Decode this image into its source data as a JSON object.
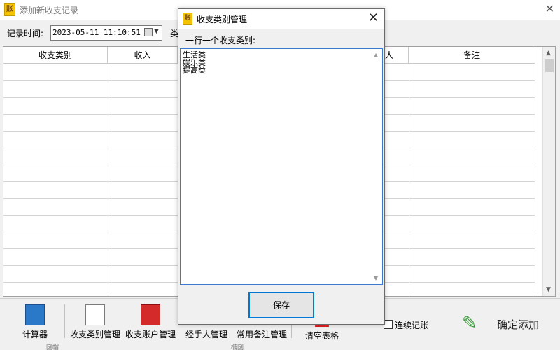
{
  "main_window": {
    "title": "添加新收支记录",
    "app_icon_text": "账",
    "close_glyph": "✕",
    "record_time_label": "记录时间:",
    "record_time_value": "2023-05-11 11:10:51",
    "type_label_partial": "类",
    "grid": {
      "columns": [
        "收支类别",
        "收入",
        "",
        "",
        "人",
        "备注"
      ]
    },
    "toolbar": {
      "calculator": "计算器",
      "category_mgmt": "收支类别管理",
      "account_mgmt": "收支账户管理",
      "handler_mgmt": "经手人管理",
      "remark_mgmt": "常用备注管理",
      "clear_table": "清空表格",
      "continuous_label": "连续记账",
      "confirm_label": "确定添加",
      "partial_left": "圆帽",
      "partial_mid": "椭圆"
    },
    "icons": {
      "calculator": "calculator-icon",
      "category": "checklist-icon",
      "account": "book-icon",
      "clear": "clear-icon",
      "confirm": "pen-check-icon"
    }
  },
  "dialog": {
    "title": "收支类别管理",
    "app_icon_text": "账",
    "close_glyph": "✕",
    "instruction": "一行一个收支类别:",
    "categories": [
      "生活类",
      "娱乐类",
      "提高类"
    ],
    "save_label": "保存"
  },
  "colors": {
    "accent": "#0078d7",
    "textarea_border": "#3b78d0",
    "app_icon": "#f5c400"
  }
}
